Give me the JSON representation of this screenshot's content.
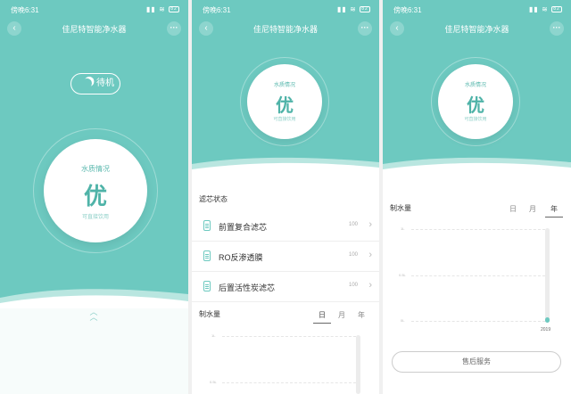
{
  "status": {
    "time": "傍晚6:31",
    "battery": "82"
  },
  "app": {
    "title": "佳尼特智能净水器"
  },
  "water_quality": {
    "label": "水质情况",
    "value": "优",
    "note": "可直接饮用"
  },
  "standby": {
    "label": "待机"
  },
  "filters": {
    "section_title": "滤芯状态",
    "items": [
      {
        "name": "前置复合滤芯",
        "value": "100"
      },
      {
        "name": "RO反渗透膜",
        "value": "100"
      },
      {
        "name": "后置活性炭滤芯",
        "value": "100"
      }
    ]
  },
  "production": {
    "title": "制水量",
    "tabs": [
      "日",
      "月",
      "年"
    ],
    "active_tab": "年",
    "yticks": [
      "1L",
      "0.5L",
      "0L"
    ],
    "chart_data": {
      "type": "bar",
      "categories": [
        "2019"
      ],
      "values": [
        0.02
      ],
      "ylabel": "",
      "ylim": [
        0,
        1
      ]
    }
  },
  "service": {
    "label": "售后服务"
  },
  "colors": {
    "accent": "#6dc9c0",
    "accent_dark": "#4fb3a8"
  },
  "icons": [
    "back-icon",
    "more-icon",
    "moon-icon",
    "chevron-up-icon",
    "filter-icon",
    "chevron-right-icon",
    "signal-icon",
    "wifi-icon",
    "battery-icon"
  ]
}
